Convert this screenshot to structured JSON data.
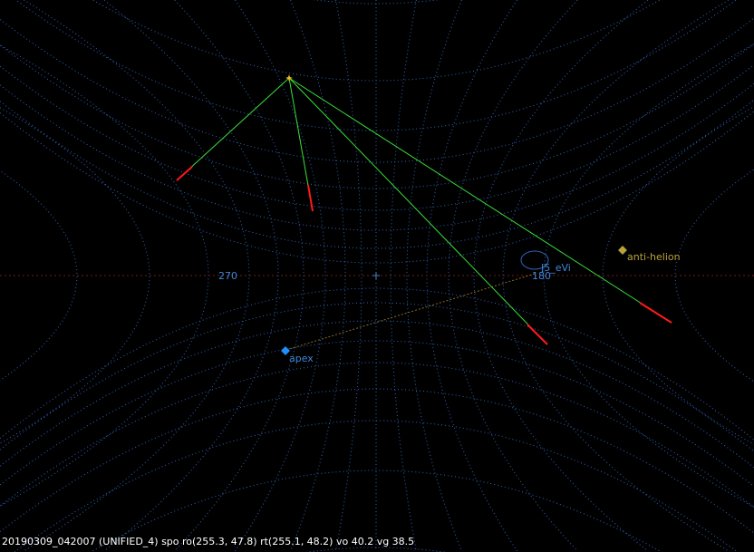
{
  "labels": {
    "az270": "270",
    "az180": "180",
    "radiant": "J5_eVi",
    "anti_helion": "anti-helion",
    "apex": "apex"
  },
  "status_line": "20190309_042007 (UNIFIED_4) spo ro(255.3, 47.8) rt(255.1, 48.2) vo 40.2 vg 38.5",
  "colors": {
    "background": "#000000",
    "grid": "#2f63b8",
    "horizon": "#7a1a12",
    "label_blue": "#3f86d8",
    "anti_helion": "#b8a23a",
    "apex": "#1f8fff",
    "trail": "#39e13a",
    "meteor": "#ff1a1a",
    "radiant_link": "#8a6a2a",
    "radiant_star": "#ffb020",
    "status_text": "#ffffff"
  },
  "icons": {
    "radiant_star": "star-icon",
    "anti_helion": "diamond-icon",
    "apex": "diamond-icon",
    "center": "crosshair-icon"
  }
}
